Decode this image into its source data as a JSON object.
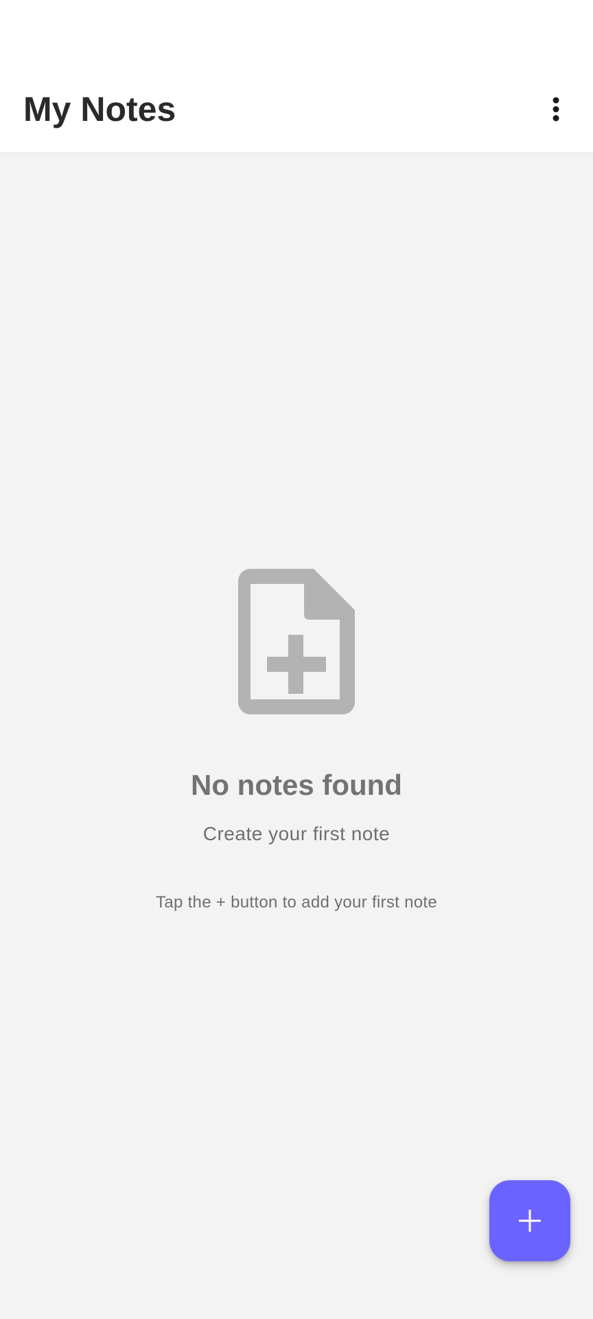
{
  "app_bar": {
    "title": "My Notes",
    "menu_icon": "more-vert-icon"
  },
  "empty_state": {
    "icon": "note-add-icon",
    "title": "No notes found",
    "subtitle": "Create your first note",
    "hint": "Tap the + button to add your first note"
  },
  "fab": {
    "icon": "add-icon"
  },
  "colors": {
    "accent": "#6b63ff",
    "background": "#f3f3f3",
    "app_bar": "#ffffff",
    "empty_icon": "#b3b3b3"
  }
}
